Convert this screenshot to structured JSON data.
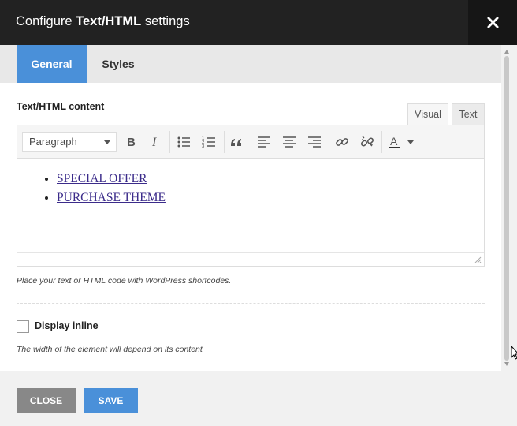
{
  "dialog": {
    "title_prefix": "Configure ",
    "title_bold": "Text/HTML",
    "title_suffix": " settings"
  },
  "tabs": [
    {
      "label": "General",
      "active": true
    },
    {
      "label": "Styles",
      "active": false
    }
  ],
  "content_section": {
    "label": "Text/HTML content",
    "mode_tabs": {
      "visual": "Visual",
      "text": "Text"
    },
    "format_select": "Paragraph",
    "list_items": [
      "SPECIAL OFFER",
      "PURCHASE THEME"
    ],
    "hint": "Place your text or HTML code with WordPress shortcodes."
  },
  "display_inline": {
    "label": "Display inline",
    "checked": false,
    "hint": "The width of the element will depend on its content"
  },
  "footer": {
    "close_label": "CLOSE",
    "save_label": "SAVE"
  },
  "colors": {
    "accent": "#4a90d9",
    "header_bg": "#222222",
    "close_button_bg": "#888888",
    "link": "#3b2b8a"
  },
  "toolbar_icons": [
    "bold-icon",
    "italic-icon",
    "bullet-list-icon",
    "numbered-list-icon",
    "blockquote-icon",
    "align-left-icon",
    "align-center-icon",
    "align-right-icon",
    "link-icon",
    "unlink-icon",
    "text-color-icon"
  ]
}
